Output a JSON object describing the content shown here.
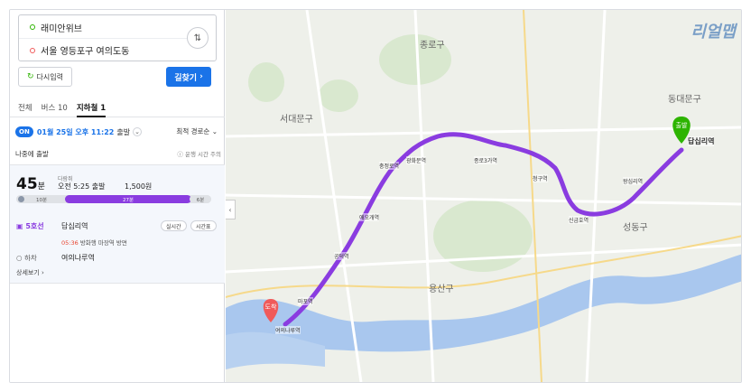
{
  "search": {
    "start": "래미안위브",
    "end": "서울 영등포구 여의도동",
    "swap_icon": "swap-vertical-icon"
  },
  "actions": {
    "reset_label": "다시입력",
    "find_label": "길찾기"
  },
  "tabs": [
    {
      "label": "전체"
    },
    {
      "label": "버스 10"
    },
    {
      "label": "지하철 1"
    }
  ],
  "departure": {
    "badge": "ON",
    "datetime": "01월 25일 오후 11:22",
    "suffix": "출발",
    "sort": "최적 경로순"
  },
  "late_departure": {
    "label": "나중에 출발",
    "info": "운행 시간 주의"
  },
  "result": {
    "duration_num": "45",
    "duration_unit": "분",
    "arrival_label": "다람쥐",
    "arrival_time": "오전 5:25 출발",
    "fare": "1,500원",
    "segments": [
      {
        "label": "10분"
      },
      {
        "label": "27분"
      },
      {
        "label": "6분"
      }
    ],
    "line": "5호선",
    "board_station": "답십리역",
    "realtime_label": "실시간",
    "timetable_label": "시간표",
    "next_train_time": "05:36",
    "next_train_dest": "방화행",
    "next_train_note": "마장역 방면",
    "alight_label": "하차",
    "alight_station": "여의나루역",
    "detail_label": "상세보기"
  },
  "map": {
    "districts": [
      "종로구",
      "서대문구",
      "용산구",
      "성동구",
      "동대문구"
    ],
    "stations": [
      "답십리역",
      "충정로역",
      "공덕역",
      "애오개역",
      "마포역",
      "여의나루역",
      "광화문역",
      "종로3가역",
      "청구역",
      "신금호역",
      "왕십리역"
    ],
    "markers": {
      "start": "출발",
      "end": "도착"
    },
    "logo": "리얼맵",
    "route_color": "#8a3ce0"
  }
}
